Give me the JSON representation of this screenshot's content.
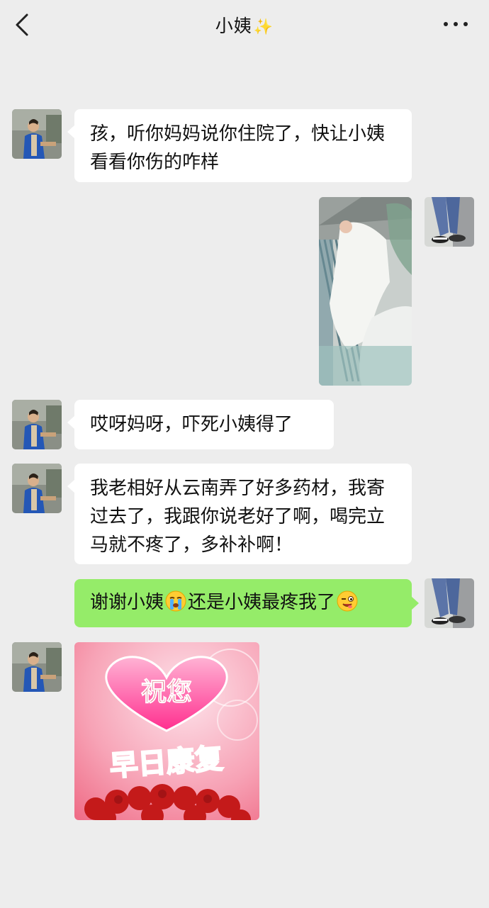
{
  "header": {
    "back_icon": "chevron-left-icon",
    "title": "小姨",
    "title_emoji": "✨",
    "more_icon": "more-dots-icon"
  },
  "messages": [
    {
      "side": "left",
      "type": "text",
      "text": "孩，听你妈妈说你住院了，快让小姨看看你伤的咋样"
    },
    {
      "side": "right",
      "type": "image",
      "image": "hospital-leg-cast-photo"
    },
    {
      "side": "left",
      "type": "text",
      "text": "哎呀妈呀，吓死小姨得了"
    },
    {
      "side": "left",
      "type": "text",
      "text": "我老相好从云南弄了好多药材，我寄过去了，我跟你说老好了啊，喝完立马就不疼了，多补补啊！"
    },
    {
      "side": "right",
      "type": "text",
      "text_part1": "谢谢小姨",
      "emoji1": "crying-face",
      "text_part2": "还是小姨最疼我了",
      "emoji2": "winking-face"
    },
    {
      "side": "left",
      "type": "image",
      "image": "get-well-card",
      "card_line1": "祝您",
      "card_line2": "早日康复"
    }
  ],
  "colors": {
    "background": "#ededed",
    "bubble_white": "#ffffff",
    "bubble_green": "#95ec69"
  }
}
